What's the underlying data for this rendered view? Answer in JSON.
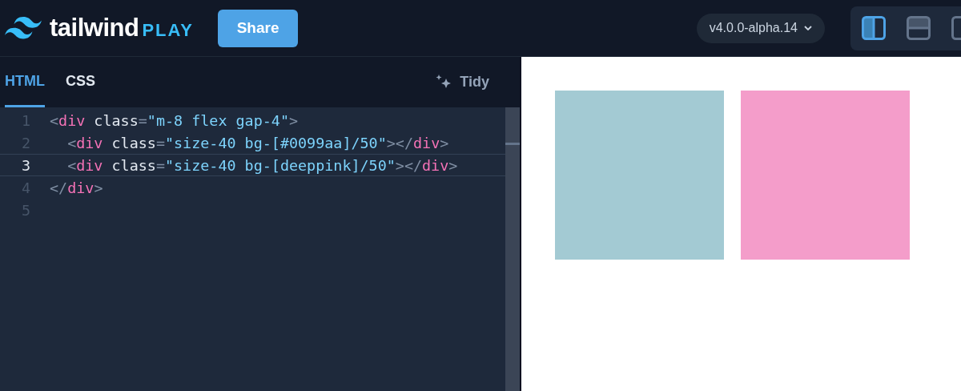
{
  "header": {
    "logo_text": "tailwind",
    "logo_suffix": "PLAY",
    "share_button": "Share",
    "version": "v4.0.0-alpha.14",
    "layouts": [
      {
        "kind": "columns",
        "selected": true
      },
      {
        "kind": "rows",
        "selected": false
      },
      {
        "kind": "preview",
        "selected": false
      }
    ]
  },
  "tabs": [
    {
      "label": "HTML",
      "selected": true
    },
    {
      "label": "CSS",
      "selected": false
    }
  ],
  "tidy_button": "Tidy",
  "editor": {
    "lines": [
      {
        "number": "1",
        "active": false,
        "tokens": [
          {
            "kind": "punct",
            "text": "<"
          },
          {
            "kind": "tag",
            "text": "div"
          },
          {
            "kind": "attr",
            "text": " class"
          },
          {
            "kind": "punct",
            "text": "="
          },
          {
            "kind": "string",
            "text": "\"m-8 flex gap-4\""
          },
          {
            "kind": "punct",
            "text": ">"
          }
        ]
      },
      {
        "number": "2",
        "active": false,
        "tokens": [
          {
            "kind": "punct",
            "text": "  <"
          },
          {
            "kind": "tag",
            "text": "div"
          },
          {
            "kind": "attr",
            "text": " class"
          },
          {
            "kind": "punct",
            "text": "="
          },
          {
            "kind": "string",
            "text": "\"size-40 bg-[#0099aa]/50\""
          },
          {
            "kind": "punct",
            "text": "></"
          },
          {
            "kind": "tag",
            "text": "div"
          },
          {
            "kind": "punct",
            "text": ">"
          }
        ]
      },
      {
        "number": "3",
        "active": true,
        "tokens": [
          {
            "kind": "punct",
            "text": "  <"
          },
          {
            "kind": "tag",
            "text": "div"
          },
          {
            "kind": "attr",
            "text": " class"
          },
          {
            "kind": "punct",
            "text": "="
          },
          {
            "kind": "string",
            "text": "\"size-40 bg-[deeppink]/50\""
          },
          {
            "kind": "punct",
            "text": "></"
          },
          {
            "kind": "tag",
            "text": "div"
          },
          {
            "kind": "punct",
            "text": ">"
          }
        ]
      },
      {
        "number": "4",
        "active": false,
        "tokens": [
          {
            "kind": "punct",
            "text": "</"
          },
          {
            "kind": "tag",
            "text": "div"
          },
          {
            "kind": "punct",
            "text": ">"
          }
        ]
      },
      {
        "number": "5",
        "active": false
      }
    ]
  },
  "preview": {
    "boxes": [
      {
        "color": "#a3cad3"
      },
      {
        "color": "#f49dca"
      }
    ]
  }
}
